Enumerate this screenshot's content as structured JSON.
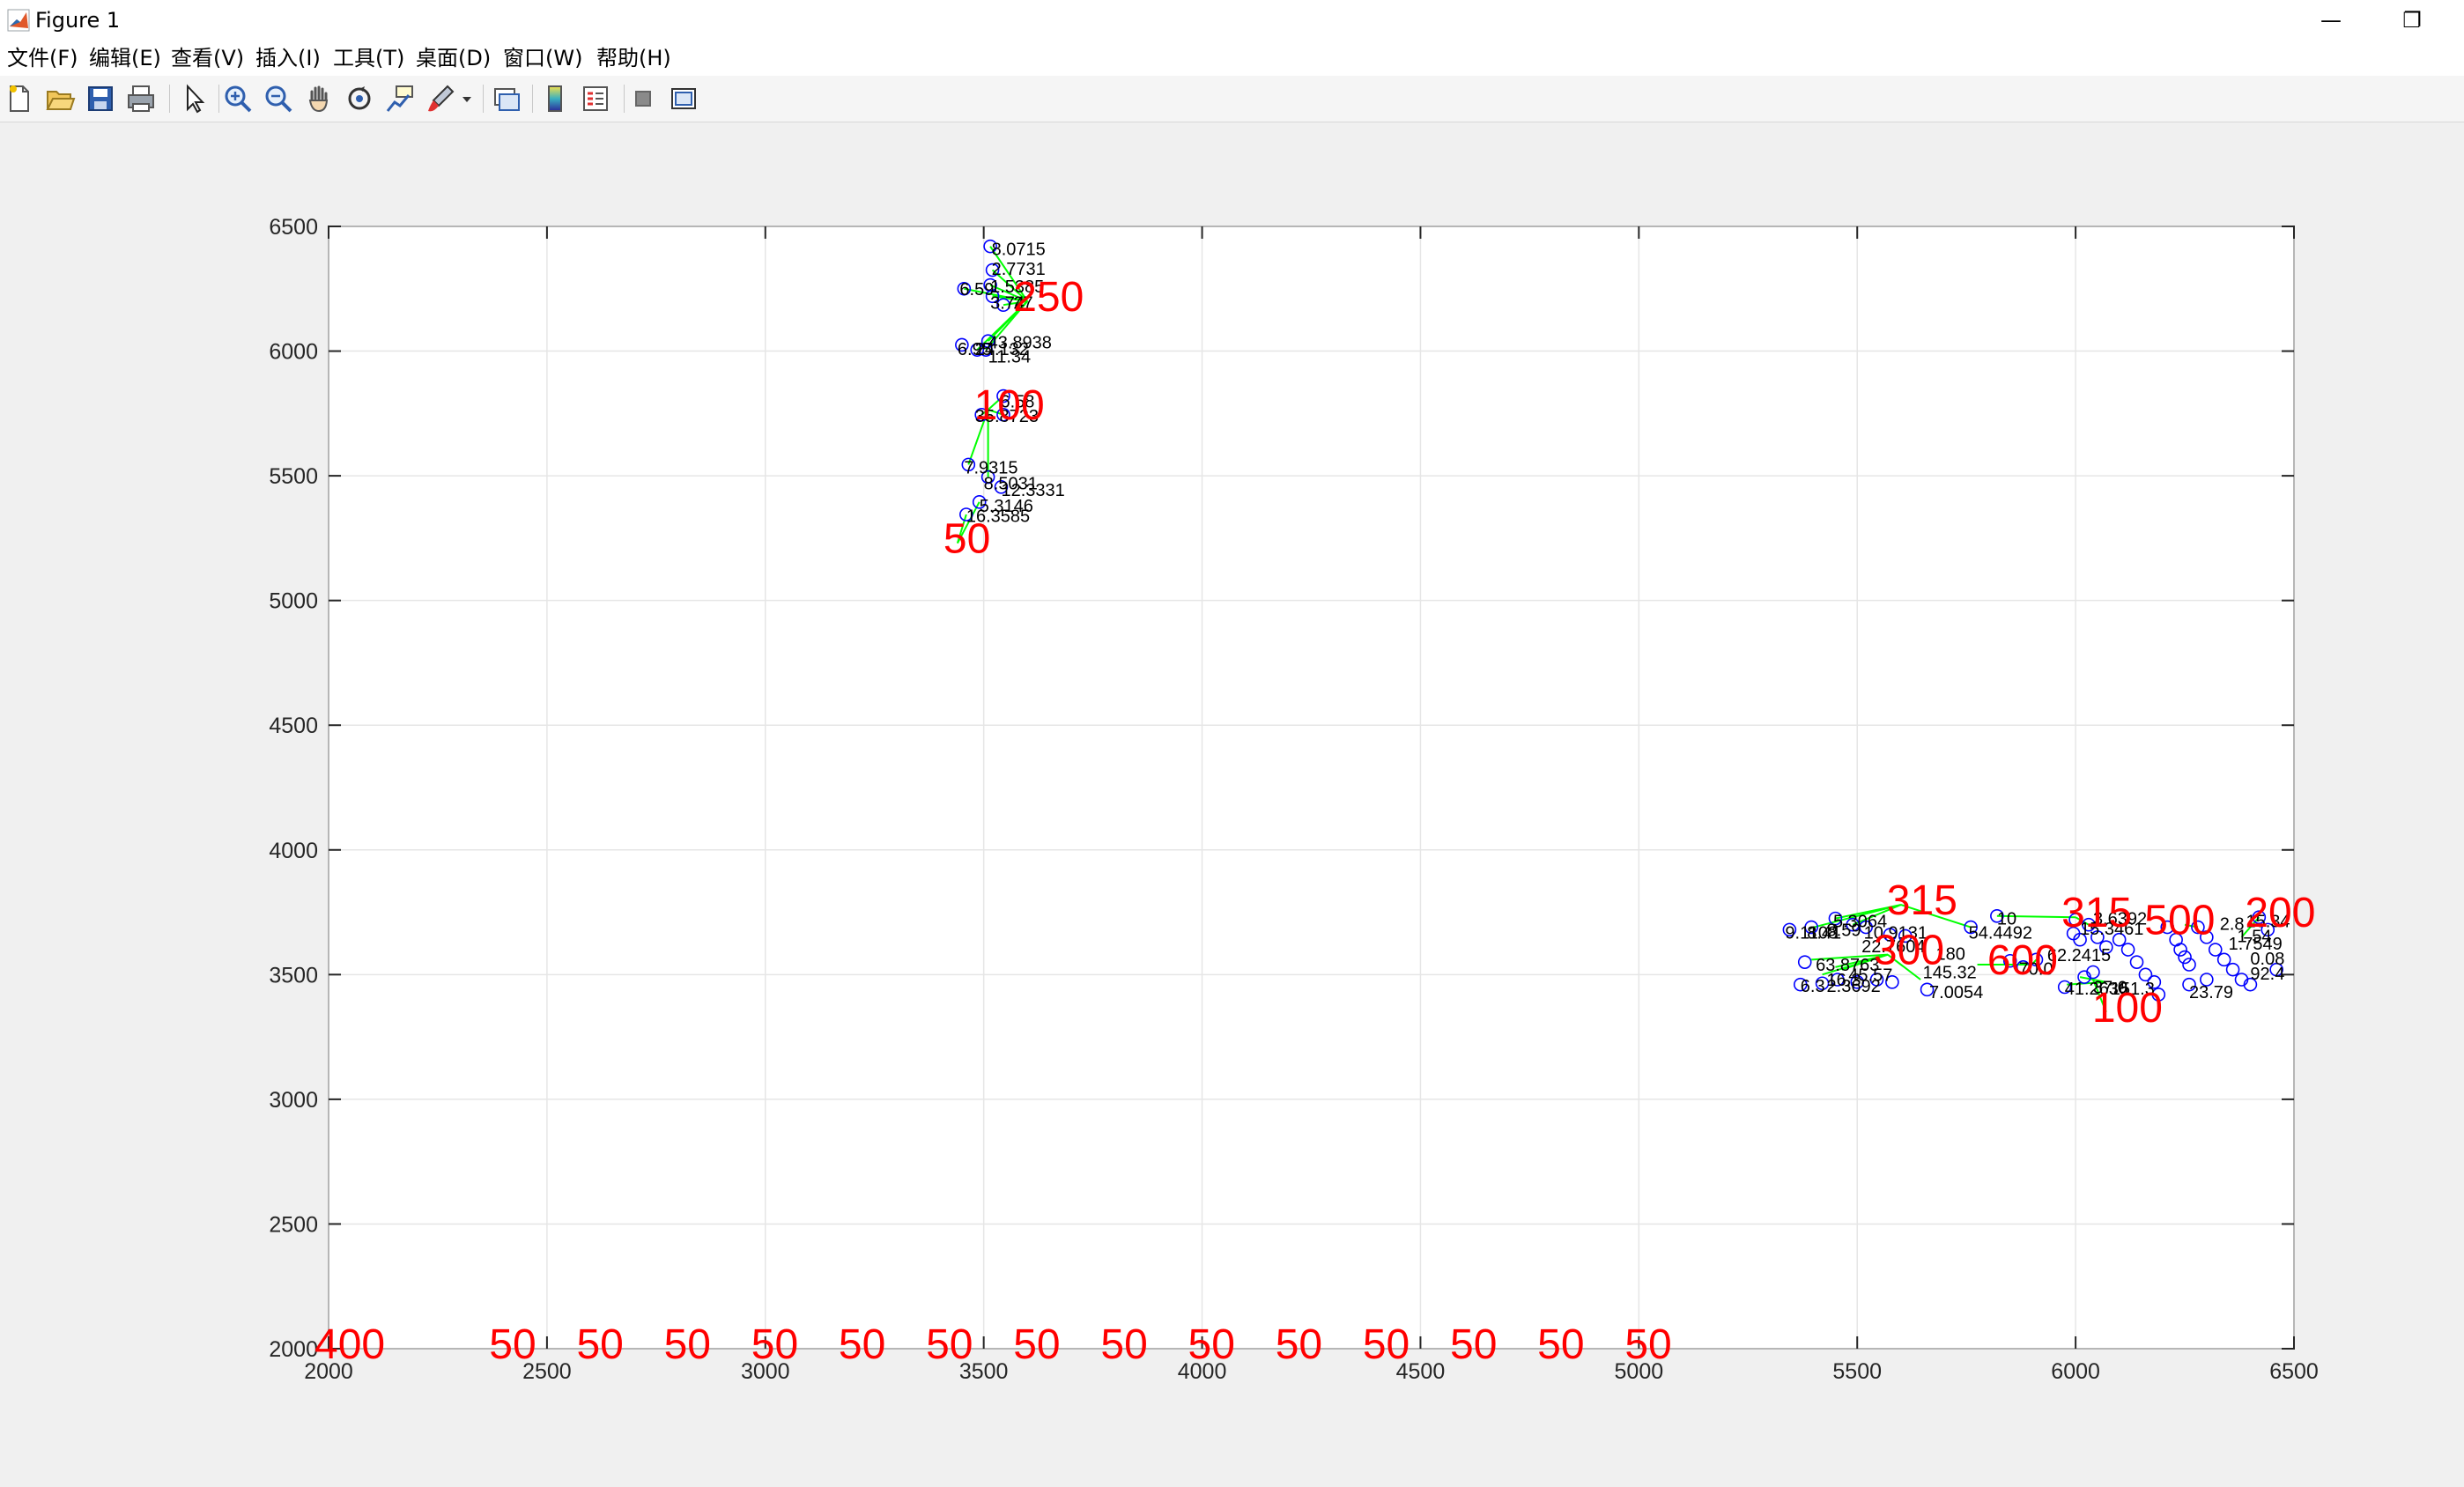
{
  "window": {
    "title": "Figure 1",
    "minimize_glyph": "—",
    "restore_glyph": "❐"
  },
  "menu": [
    "文件(F)",
    "编辑(E)",
    "查看(V)",
    "插入(I)",
    "工具(T)",
    "桌面(D)",
    "窗口(W)",
    "帮助(H)"
  ],
  "toolbar": {
    "icons": [
      "new-figure-icon",
      "open-file-icon",
      "save-icon",
      "print-icon",
      "select-arrow-icon",
      "zoom-in-icon",
      "zoom-out-icon",
      "pan-hand-icon",
      "rotate-3d-icon",
      "data-cursor-icon",
      "brush-icon",
      "link-plot-icon",
      "colorbar-icon",
      "legend-icon",
      "hide-plot-tools-icon",
      "show-plot-tools-icon"
    ]
  },
  "colors": {
    "label_red": "#ff0000",
    "edge_green": "#00ff00",
    "node_blue": "#0000ff",
    "grid": "#e6e6e6"
  },
  "chart_data": {
    "type": "scatter",
    "title": "",
    "xlabel": "",
    "ylabel": "",
    "xlim": [
      2000,
      6500
    ],
    "ylim": [
      2000,
      6500
    ],
    "xticks": [
      2000,
      2500,
      3000,
      3500,
      4000,
      4500,
      5000,
      5500,
      6000,
      6500
    ],
    "yticks": [
      2000,
      2500,
      3000,
      3500,
      4000,
      4500,
      5000,
      5500,
      6000,
      6500
    ],
    "grid": true,
    "edges": [
      [
        3600,
        6200,
        3515,
        6420
      ],
      [
        3600,
        6200,
        3520,
        6325
      ],
      [
        3600,
        6200,
        3455,
        6250
      ],
      [
        3600,
        6200,
        3515,
        6265
      ],
      [
        3600,
        6200,
        3520,
        6220
      ],
      [
        3600,
        6200,
        3545,
        6185
      ],
      [
        3600,
        6200,
        3510,
        6040
      ],
      [
        3600,
        6200,
        3505,
        6005
      ],
      [
        3600,
        6200,
        3485,
        6005
      ],
      [
        3510,
        5765,
        3545,
        5820
      ],
      [
        3510,
        5765,
        3495,
        5745
      ],
      [
        3510,
        5765,
        3545,
        5745
      ],
      [
        3510,
        5765,
        3465,
        5545
      ],
      [
        3510,
        5765,
        3510,
        5495
      ],
      [
        3440,
        5230,
        3490,
        5395
      ],
      [
        3440,
        5230,
        3460,
        5345
      ],
      [
        5600,
        3780,
        5450,
        3725
      ],
      [
        5600,
        3780,
        5490,
        3700
      ],
      [
        5600,
        3780,
        5760,
        3690
      ],
      [
        5600,
        3780,
        5390,
        3685
      ],
      [
        5900,
        3540,
        5775,
        3540
      ],
      [
        5900,
        3540,
        5910,
        3560
      ],
      [
        6000,
        3730,
        5820,
        3735
      ],
      [
        6000,
        3730,
        6030,
        3700
      ],
      [
        6250,
        3700,
        6280,
        3690
      ],
      [
        6420,
        3730,
        6380,
        3650
      ],
      [
        6070,
        3470,
        5980,
        3460
      ],
      [
        6070,
        3470,
        6010,
        3490
      ],
      [
        6070,
        3350,
        6040,
        3480
      ],
      [
        5570,
        3580,
        5450,
        3530
      ],
      [
        5570,
        3580,
        5420,
        3500
      ],
      [
        5570,
        3580,
        5395,
        3560
      ],
      [
        5570,
        3580,
        5465,
        3520
      ],
      [
        5570,
        3580,
        5645,
        3480
      ]
    ],
    "nodes": [
      [
        3515,
        6420
      ],
      [
        3520,
        6325
      ],
      [
        3455,
        6250
      ],
      [
        3515,
        6265
      ],
      [
        3520,
        6220
      ],
      [
        3545,
        6185
      ],
      [
        3510,
        6040
      ],
      [
        3505,
        6005
      ],
      [
        3485,
        6005
      ],
      [
        3450,
        6025
      ],
      [
        3545,
        5820
      ],
      [
        3495,
        5745
      ],
      [
        3545,
        5745
      ],
      [
        3465,
        5545
      ],
      [
        3510,
        5495
      ],
      [
        3540,
        5455
      ],
      [
        3490,
        5395
      ],
      [
        3460,
        5345
      ],
      [
        5345,
        3680
      ],
      [
        5395,
        3690
      ],
      [
        5450,
        3725
      ],
      [
        5490,
        3700
      ],
      [
        5520,
        3690
      ],
      [
        5575,
        3660
      ],
      [
        5610,
        3655
      ],
      [
        5760,
        3690
      ],
      [
        5380,
        3550
      ],
      [
        5370,
        3460
      ],
      [
        5420,
        3465
      ],
      [
        5455,
        3480
      ],
      [
        5500,
        3470
      ],
      [
        5545,
        3480
      ],
      [
        5580,
        3470
      ],
      [
        5660,
        3440
      ],
      [
        5820,
        3735
      ],
      [
        5850,
        3555
      ],
      [
        5880,
        3530
      ],
      [
        5910,
        3560
      ],
      [
        5975,
        3450
      ],
      [
        5995,
        3665
      ],
      [
        6000,
        3720
      ],
      [
        6010,
        3640
      ],
      [
        6030,
        3700
      ],
      [
        6050,
        3650
      ],
      [
        6070,
        3610
      ],
      [
        6100,
        3640
      ],
      [
        6120,
        3600
      ],
      [
        6140,
        3550
      ],
      [
        6160,
        3500
      ],
      [
        6180,
        3470
      ],
      [
        6190,
        3420
      ],
      [
        6210,
        3690
      ],
      [
        6230,
        3640
      ],
      [
        6240,
        3600
      ],
      [
        6250,
        3570
      ],
      [
        6260,
        3540
      ],
      [
        6280,
        3690
      ],
      [
        6300,
        3650
      ],
      [
        6320,
        3600
      ],
      [
        6340,
        3560
      ],
      [
        6360,
        3520
      ],
      [
        6380,
        3480
      ],
      [
        6400,
        3460
      ],
      [
        6420,
        3730
      ],
      [
        6440,
        3680
      ],
      [
        6460,
        3520
      ],
      [
        6300,
        3480
      ],
      [
        6260,
        3460
      ],
      [
        6020,
        3490
      ],
      [
        6040,
        3510
      ]
    ],
    "node_labels": [
      {
        "x": 3518,
        "y": 6385,
        "text": "8.0715"
      },
      {
        "x": 3518,
        "y": 6305,
        "text": "2.7731"
      },
      {
        "x": 3445,
        "y": 6225,
        "text": "6.59"
      },
      {
        "x": 3515,
        "y": 6235,
        "text": "1.5385"
      },
      {
        "x": 3515,
        "y": 6170,
        "text": "3.74"
      },
      {
        "x": 3568,
        "y": 6170,
        "text": "27"
      },
      {
        "x": 3510,
        "y": 6010,
        "text": "43.8938"
      },
      {
        "x": 3440,
        "y": 5985,
        "text": "6.95"
      },
      {
        "x": 3480,
        "y": 5985,
        "text": "24.132"
      },
      {
        "x": 3510,
        "y": 5955,
        "text": "11.34"
      },
      {
        "x": 3538,
        "y": 5775,
        "text": "6.58"
      },
      {
        "x": 3480,
        "y": 5715,
        "text": "35.8723"
      },
      {
        "x": 3455,
        "y": 5510,
        "text": "7.9315"
      },
      {
        "x": 3500,
        "y": 5445,
        "text": "8.5031"
      },
      {
        "x": 3540,
        "y": 5420,
        "text": "12.3331"
      },
      {
        "x": 3490,
        "y": 5355,
        "text": "5.3146"
      },
      {
        "x": 3460,
        "y": 5315,
        "text": "16.3585"
      },
      {
        "x": 5335,
        "y": 3645,
        "text": "9.1108"
      },
      {
        "x": 5385,
        "y": 3645,
        "text": "8.41"
      },
      {
        "x": 5430,
        "y": 3655,
        "text": "8.59"
      },
      {
        "x": 5445,
        "y": 3690,
        "text": "5.3064"
      },
      {
        "x": 5515,
        "y": 3645,
        "text": "10.9131"
      },
      {
        "x": 5755,
        "y": 3645,
        "text": "54.4492"
      },
      {
        "x": 5510,
        "y": 3590,
        "text": "22.7604"
      },
      {
        "x": 5405,
        "y": 3515,
        "text": "63.8763"
      },
      {
        "x": 5430,
        "y": 3455,
        "text": "16.3"
      },
      {
        "x": 5480,
        "y": 3475,
        "text": "45.57"
      },
      {
        "x": 5370,
        "y": 3430,
        "text": "6.3"
      },
      {
        "x": 5430,
        "y": 3430,
        "text": "2.3692"
      },
      {
        "x": 5650,
        "y": 3485,
        "text": "145.32"
      },
      {
        "x": 5665,
        "y": 3405,
        "text": "7.0054"
      },
      {
        "x": 5680,
        "y": 3560,
        "text": "180"
      },
      {
        "x": 5820,
        "y": 3700,
        "text": "10"
      },
      {
        "x": 5935,
        "y": 3555,
        "text": "62.2415"
      },
      {
        "x": 5870,
        "y": 3500,
        "text": "70.0"
      },
      {
        "x": 5975,
        "y": 3420,
        "text": "41.2636"
      },
      {
        "x": 6040,
        "y": 3425,
        "text": "37.0"
      },
      {
        "x": 6080,
        "y": 3420,
        "text": "151.3"
      },
      {
        "x": 6260,
        "y": 3405,
        "text": "23.79"
      },
      {
        "x": 6400,
        "y": 3480,
        "text": "92.4"
      },
      {
        "x": 6330,
        "y": 3680,
        "text": "2.8"
      },
      {
        "x": 6390,
        "y": 3690,
        "text": "15.34"
      },
      {
        "x": 6370,
        "y": 3630,
        "text": "1.54"
      },
      {
        "x": 6400,
        "y": 3540,
        "text": "0.08"
      },
      {
        "x": 6350,
        "y": 3600,
        "text": "1.7549"
      },
      {
        "x": 6010,
        "y": 3660,
        "text": "15.3461"
      },
      {
        "x": 6040,
        "y": 3700,
        "text": "3.6392"
      }
    ],
    "big_labels": [
      {
        "x": 2000,
        "y": 2000,
        "text": "400"
      },
      {
        "x": 2400,
        "y": 2000,
        "text": "50"
      },
      {
        "x": 2600,
        "y": 2000,
        "text": "50"
      },
      {
        "x": 2800,
        "y": 2000,
        "text": "50"
      },
      {
        "x": 3000,
        "y": 2000,
        "text": "50"
      },
      {
        "x": 3200,
        "y": 2000,
        "text": "50"
      },
      {
        "x": 3400,
        "y": 2000,
        "text": "50"
      },
      {
        "x": 3600,
        "y": 2000,
        "text": "50"
      },
      {
        "x": 3800,
        "y": 2000,
        "text": "50"
      },
      {
        "x": 4000,
        "y": 2000,
        "text": "50"
      },
      {
        "x": 4200,
        "y": 2000,
        "text": "50"
      },
      {
        "x": 4400,
        "y": 2000,
        "text": "50"
      },
      {
        "x": 4600,
        "y": 2000,
        "text": "50"
      },
      {
        "x": 4800,
        "y": 2000,
        "text": "50"
      },
      {
        "x": 5000,
        "y": 2000,
        "text": "50"
      },
      {
        "x": 3600,
        "y": 6200,
        "text": "250"
      },
      {
        "x": 3510,
        "y": 5765,
        "text": "100"
      },
      {
        "x": 3440,
        "y": 5230,
        "text": "50"
      },
      {
        "x": 5570,
        "y": 3580,
        "text": "300"
      },
      {
        "x": 5600,
        "y": 3780,
        "text": "315"
      },
      {
        "x": 6000,
        "y": 3730,
        "text": "315"
      },
      {
        "x": 5830,
        "y": 3540,
        "text": "600"
      },
      {
        "x": 6190,
        "y": 3700,
        "text": "500"
      },
      {
        "x": 6070,
        "y": 3350,
        "text": "100"
      },
      {
        "x": 6420,
        "y": 3730,
        "text": "200"
      }
    ]
  }
}
